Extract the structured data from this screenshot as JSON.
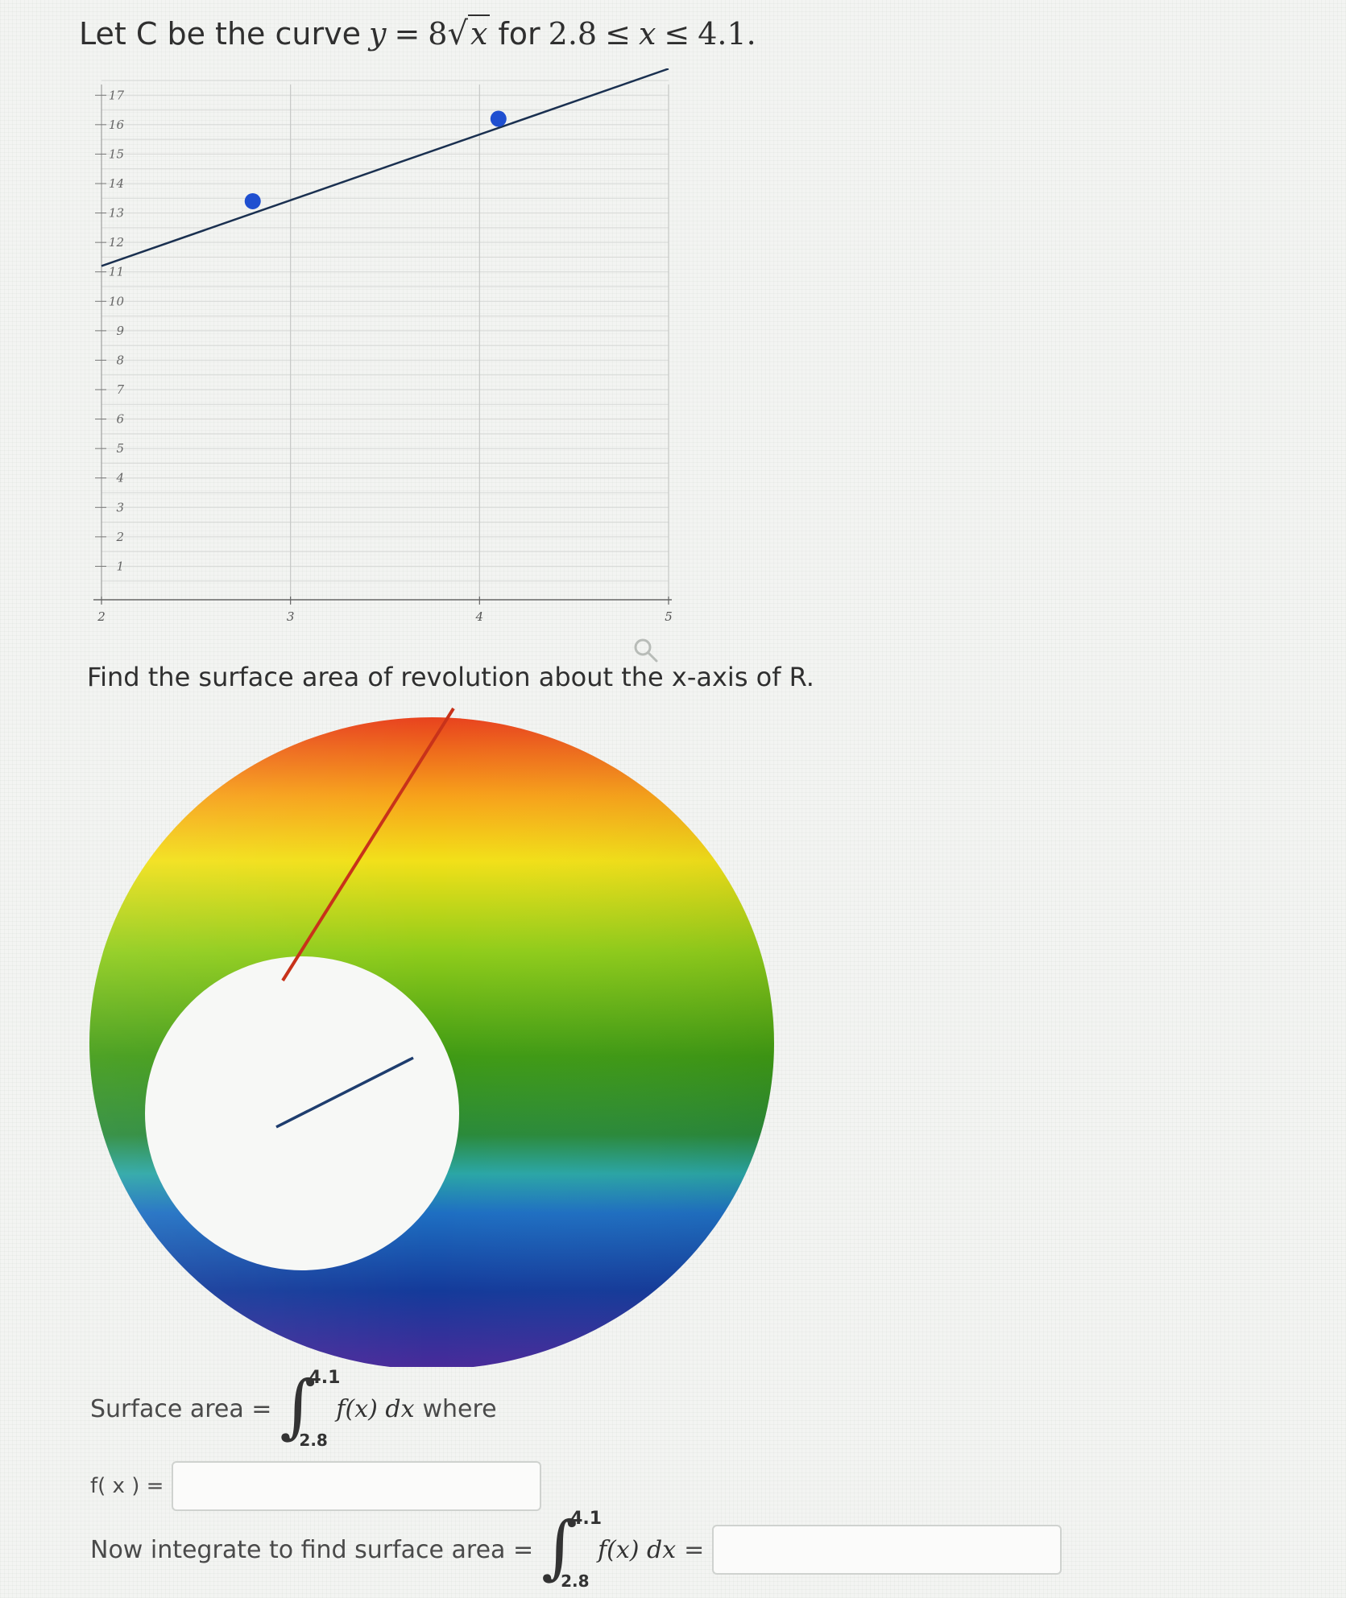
{
  "problem": {
    "prefix": "Let C be the curve",
    "y_var": "y",
    "eq": "=",
    "coef": "8",
    "x_var": "x",
    "for_word": "for",
    "lower": "2.8",
    "leq1": "≤",
    "x_var2": "x",
    "leq2": "≤",
    "upper": "4.1."
  },
  "chart_data": {
    "type": "line",
    "series": [
      {
        "x": [
          2,
          5
        ],
        "y": [
          11.2,
          17.9
        ]
      }
    ],
    "points": [
      {
        "x": 2.8,
        "y": 13.4
      },
      {
        "x": 4.1,
        "y": 16.2
      }
    ],
    "x_ticks": [
      "2",
      "3",
      "4",
      "5"
    ],
    "y_ticks": [
      "1",
      "2",
      "3",
      "4",
      "5",
      "6",
      "7",
      "8",
      "9",
      "10",
      "11",
      "12",
      "13",
      "14",
      "15",
      "16",
      "17"
    ],
    "xlim": [
      2,
      5
    ],
    "ylim": [
      0,
      17.5
    ],
    "grid": true,
    "line_color": "#1a3050",
    "point_color": "#1f4fd0"
  },
  "find_text": "Find the surface area of revolution about the x-axis of R.",
  "surface_area": {
    "label": "Surface area =",
    "upper": "4.1",
    "lower": "2.8",
    "integrand": "f(x) dx",
    "suffix": "where"
  },
  "fx": {
    "label": "f( x ) =",
    "value": ""
  },
  "final": {
    "label": "Now integrate to find surface area =",
    "upper": "4.1",
    "lower": "2.8",
    "integrand": "f(x) dx",
    "equals": "=",
    "value": ""
  },
  "icons": {
    "zoom": "magnifier-icon"
  }
}
